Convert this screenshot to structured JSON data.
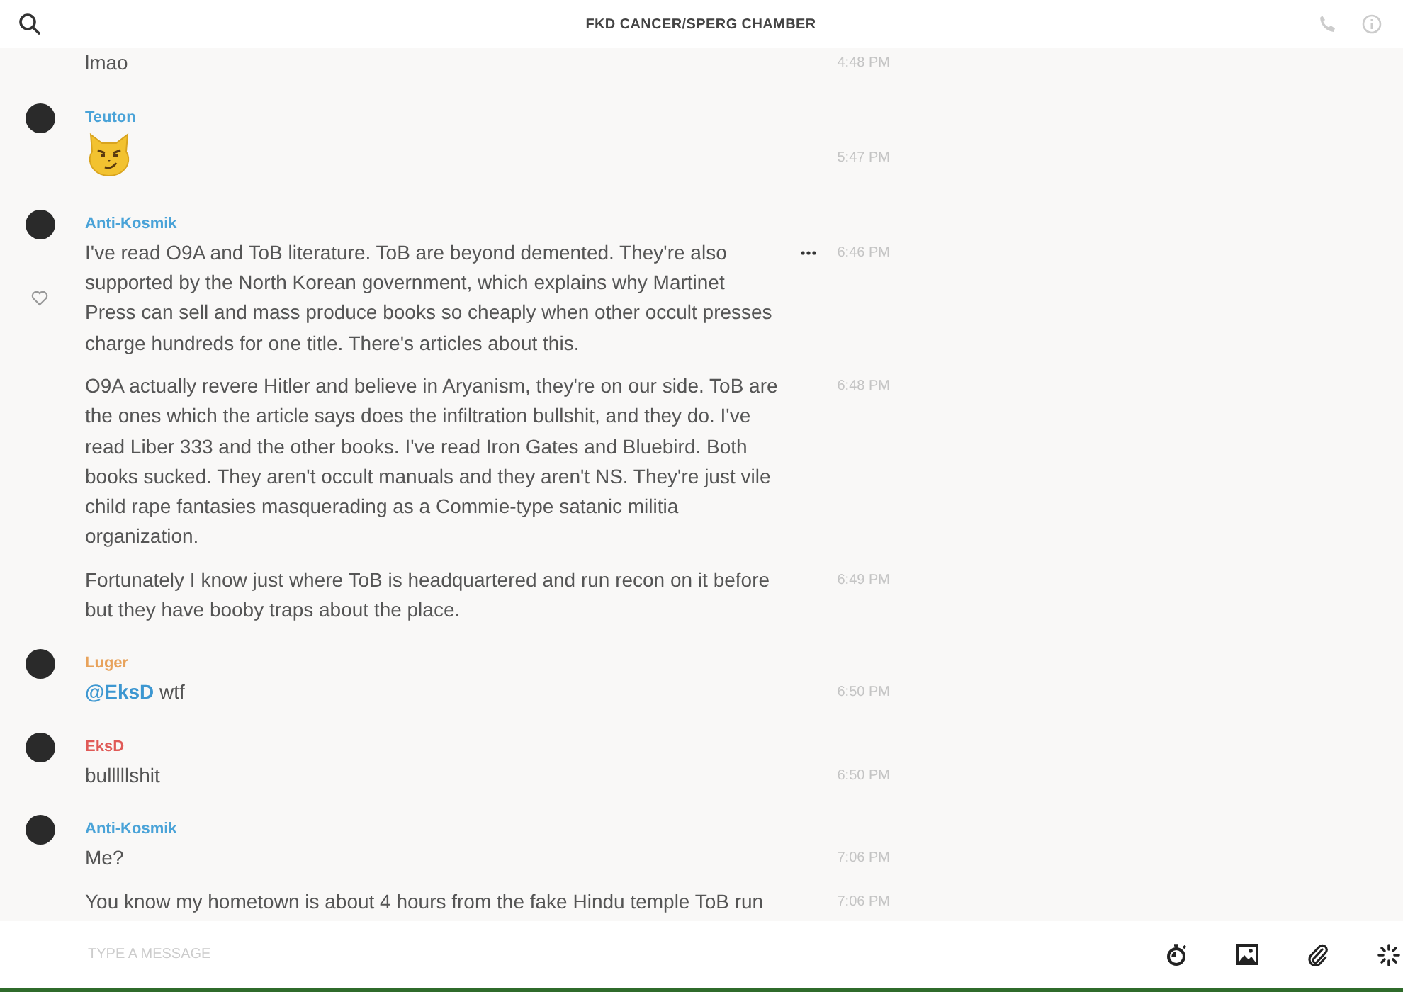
{
  "header": {
    "title": "FKD CANCER/SPERG CHAMBER"
  },
  "groups": [
    {
      "messages": [
        {
          "kind": "text",
          "text": "lmao",
          "time": "4:48 PM",
          "hovered": false
        }
      ]
    },
    {
      "author": "Teuton",
      "color": "#4aa3d8",
      "messages": [
        {
          "kind": "sticker",
          "time": "5:47 PM",
          "hovered": false
        }
      ]
    },
    {
      "author": "Anti-Kosmik",
      "color": "#4aa3d8",
      "messages": [
        {
          "kind": "text",
          "text": "I've read O9A and ToB literature. ToB are beyond demented. They're also supported by the North Korean government, which explains why Martinet Press can sell and mass produce books so cheaply when other occult presses charge hundreds for one title. There's articles about this.",
          "time": "6:46 PM",
          "hovered": true
        },
        {
          "kind": "text",
          "text": "O9A actually revere Hitler and believe in Aryanism, they're on our side. ToB are the ones which the article says does the infiltration bullshit, and they do. I've read Liber 333 and the other books. I've read Iron Gates and Bluebird. Both books sucked. They aren't occult manuals and they aren't NS. They're just vile child rape fantasies masquerading as a Commie-type satanic militia organization.",
          "time": "6:48 PM",
          "hovered": false
        },
        {
          "kind": "text",
          "text": "Fortunately I know just where ToB is headquartered and run recon on it before but they have booby traps about the place.",
          "time": "6:49 PM",
          "hovered": false
        }
      ]
    },
    {
      "author": "Luger",
      "color": "#e8a25a",
      "messages": [
        {
          "kind": "text",
          "mention": "@EksD",
          "text": "wtf",
          "time": "6:50 PM",
          "hovered": false
        }
      ]
    },
    {
      "author": "EksD",
      "color": "#e05a57",
      "messages": [
        {
          "kind": "text",
          "text": "bulllllshit",
          "time": "6:50 PM",
          "hovered": false
        }
      ]
    },
    {
      "author": "Anti-Kosmik",
      "color": "#4aa3d8",
      "messages": [
        {
          "kind": "text",
          "text": "Me?",
          "time": "7:06 PM",
          "hovered": false
        },
        {
          "kind": "text",
          "text": "You know my hometown is about 4 hours from the fake Hindu temple ToB run",
          "time": "7:06 PM",
          "hovered": false
        }
      ]
    }
  ],
  "composer": {
    "placeholder": "TYPE A MESSAGE"
  }
}
